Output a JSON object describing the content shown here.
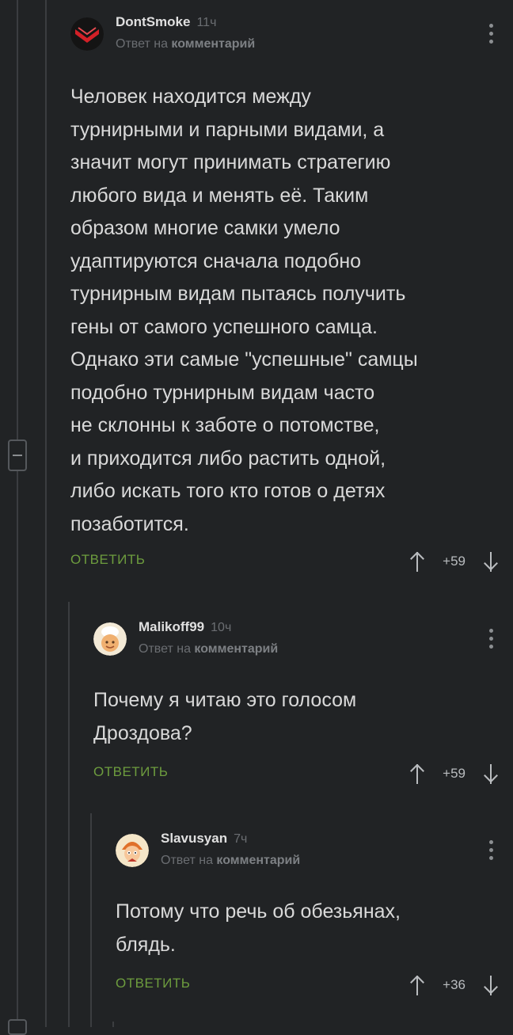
{
  "comments": [
    {
      "username": "DontSmoke",
      "time": "11ч",
      "reply_prefix": "Ответ на",
      "reply_target": "комментарий",
      "text": "Человек находится между\nтурнирными и парными видами, а\nзначит могут принимать стратегию\nлюбого вида и менять её. Таким\nобразом многие самки умело\nудаптируются сначала подобно\nтурнирным видам пытаясь получить\nгены от самого успешного самца.\nОднако эти самые \"успешные\" самцы\nподобно турнирным видам часто\nне склонны к заботе о потомстве,\nи приходится либо растить одной,\nлибо искать того кто готов о детях\nпозаботится.",
      "reply_label": "ОТВЕТИТЬ",
      "score": "+59",
      "avatar_icon": "red-chevron-logo-icon"
    },
    {
      "username": "Malikoff99",
      "time": "10ч",
      "reply_prefix": "Ответ на",
      "reply_target": "комментарий",
      "text": "Почему я читаю это голосом\nДроздова?",
      "reply_label": "ОТВЕТИТЬ",
      "score": "+59",
      "avatar_icon": "chef-avatar-icon"
    },
    {
      "username": "Slavusyan",
      "time": "7ч",
      "reply_prefix": "Ответ на",
      "reply_target": "комментарий",
      "text": "Потому что речь об обезьянах,\nблядь.",
      "reply_label": "ОТВЕТИТЬ",
      "score": "+36",
      "avatar_icon": "cartoon-character-avatar-icon"
    }
  ],
  "colors": {
    "background": "#212325",
    "reply_green": "#6d9c3e",
    "thread_line": "#3b3d40"
  }
}
